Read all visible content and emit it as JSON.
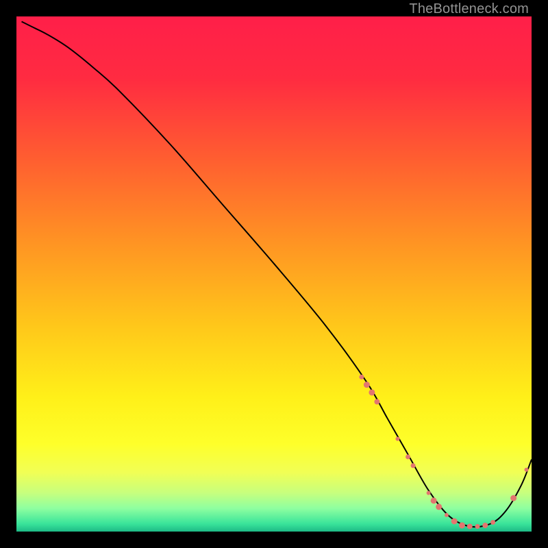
{
  "watermark": "TheBottleneck.com",
  "chart_data": {
    "type": "line",
    "title": "",
    "xlabel": "",
    "ylabel": "",
    "xlim": [
      0,
      100
    ],
    "ylim": [
      0,
      100
    ],
    "grid": false,
    "legend": false,
    "series": [
      {
        "name": "curve",
        "x": [
          1,
          3,
          6,
          10,
          15,
          20,
          30,
          40,
          50,
          60,
          68,
          72,
          76,
          80,
          84,
          88,
          92,
          95,
          98,
          100
        ],
        "y": [
          99,
          98,
          96.5,
          94,
          90,
          85.5,
          75,
          63.5,
          52,
          40,
          29,
          22,
          15,
          8,
          3,
          1,
          1.5,
          4,
          9,
          14
        ]
      }
    ],
    "markers": {
      "name": "highlight-points",
      "color": "#e2766f",
      "points": [
        {
          "x": 67,
          "y": 30.0,
          "r": 3.5
        },
        {
          "x": 68,
          "y": 28.5,
          "r": 4.5
        },
        {
          "x": 69,
          "y": 27.0,
          "r": 4.5
        },
        {
          "x": 70,
          "y": 25.2,
          "r": 4.0
        },
        {
          "x": 74,
          "y": 18.0,
          "r": 3.0
        },
        {
          "x": 76,
          "y": 14.5,
          "r": 3.5
        },
        {
          "x": 77,
          "y": 12.8,
          "r": 3.5
        },
        {
          "x": 80,
          "y": 7.5,
          "r": 3.0
        },
        {
          "x": 81,
          "y": 6.0,
          "r": 4.5
        },
        {
          "x": 82,
          "y": 4.8,
          "r": 4.5
        },
        {
          "x": 83.5,
          "y": 3.2,
          "r": 3.0
        },
        {
          "x": 85,
          "y": 2.0,
          "r": 4.5
        },
        {
          "x": 86.5,
          "y": 1.2,
          "r": 4.5
        },
        {
          "x": 88,
          "y": 1.0,
          "r": 4.0
        },
        {
          "x": 89.5,
          "y": 1.0,
          "r": 3.5
        },
        {
          "x": 91,
          "y": 1.2,
          "r": 4.0
        },
        {
          "x": 92.5,
          "y": 1.8,
          "r": 3.5
        },
        {
          "x": 96.5,
          "y": 6.5,
          "r": 4.5
        },
        {
          "x": 99,
          "y": 12.0,
          "r": 3.0
        }
      ]
    },
    "background_gradient": {
      "stops": [
        {
          "offset": 0.0,
          "color": "#ff1f49"
        },
        {
          "offset": 0.12,
          "color": "#ff2b41"
        },
        {
          "offset": 0.28,
          "color": "#ff5f30"
        },
        {
          "offset": 0.44,
          "color": "#ff9423"
        },
        {
          "offset": 0.6,
          "color": "#ffc71a"
        },
        {
          "offset": 0.74,
          "color": "#fff019"
        },
        {
          "offset": 0.83,
          "color": "#feff2a"
        },
        {
          "offset": 0.885,
          "color": "#f1ff55"
        },
        {
          "offset": 0.925,
          "color": "#c7ff7e"
        },
        {
          "offset": 0.955,
          "color": "#8effa0"
        },
        {
          "offset": 0.985,
          "color": "#39e49a"
        },
        {
          "offset": 1.0,
          "color": "#1dba86"
        }
      ]
    }
  }
}
